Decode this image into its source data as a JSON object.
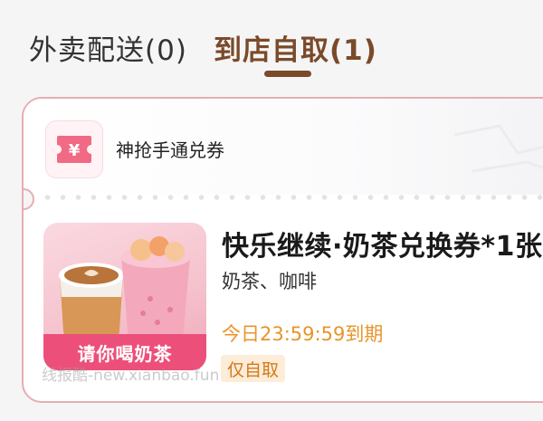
{
  "tabs": {
    "delivery_label": "外卖配送(0)",
    "pickup_label": "到店自取(1)"
  },
  "voucher": {
    "icon_symbol": "¥",
    "title": "神抢手通兑券"
  },
  "product": {
    "name": "快乐继续·奶茶兑换券*1张",
    "category": "奶茶、咖啡",
    "expiry": "今日23:59:59到期",
    "tag": "仅自取",
    "image_banner": "请你喝奶茶"
  },
  "watermark": "线报酷-new.xianbao.fun",
  "colors": {
    "accent_brown": "#7a4a2a",
    "card_border": "#e4aeb3",
    "expiry_orange": "#e8942a",
    "tag_bg": "#fdecd7",
    "banner_pink": "#ec4f7a"
  }
}
